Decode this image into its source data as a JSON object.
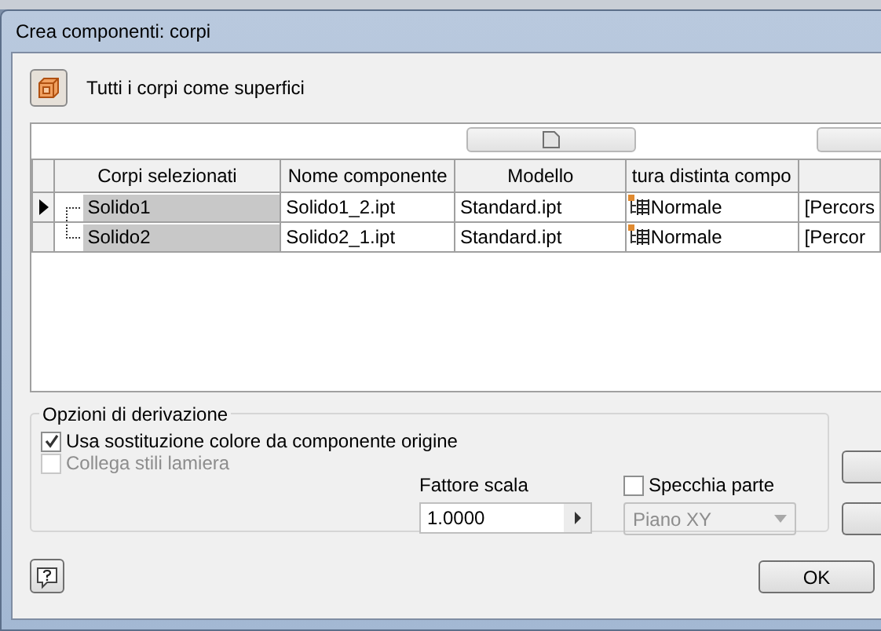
{
  "window": {
    "title": "Crea componenti: corpi"
  },
  "mode": {
    "label": "Tutti i corpi come superfici"
  },
  "table": {
    "columns": [
      "Corpi selezionati",
      "Nome componente",
      "Modello",
      "tura distinta compo"
    ],
    "rows": [
      {
        "current": true,
        "body": "Solido1",
        "component_name": "Solido1_2.ipt",
        "model": "Standard.ipt",
        "bom_structure": "Normale",
        "column_5": "[Percors"
      },
      {
        "current": false,
        "body": "Solido2",
        "component_name": "Solido2_1.ipt",
        "model": "Standard.ipt",
        "bom_structure": "Normale",
        "column_5": "[Percor"
      }
    ]
  },
  "options": {
    "title": "Opzioni di derivazione",
    "checkboxes": [
      {
        "label": "Usa sostituzione colore da componente origine",
        "checked": true,
        "disabled": false
      },
      {
        "label": "Collega stili lamiera",
        "checked": false,
        "disabled": true
      }
    ],
    "scale": {
      "label": "Fattore scala",
      "value": "1.0000"
    },
    "mirror": {
      "label": "Specchia parte",
      "checked": false
    },
    "plane": {
      "value": "Piano XY",
      "disabled": true
    }
  },
  "buttons": {
    "ok": "OK"
  }
}
